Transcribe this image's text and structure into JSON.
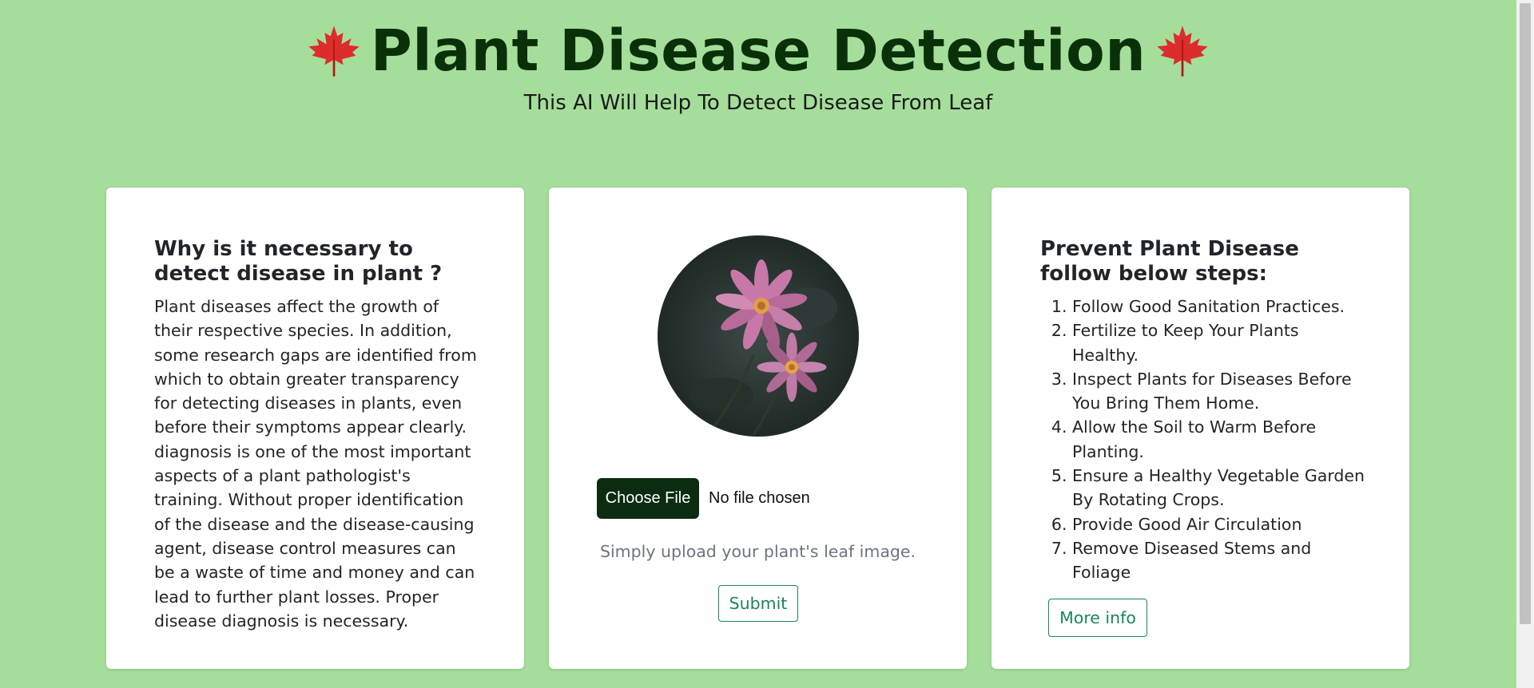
{
  "header": {
    "title": "Plant Disease Detection",
    "subtitle": "This AI Will Help To Detect Disease From Leaf",
    "icon": "maple-leaf-icon"
  },
  "why_card": {
    "heading": "Why is it necessary to detect disease in plant ?",
    "body": "Plant diseases affect the growth of their respective species. In addition, some research gaps are identified from which to obtain greater transparency for detecting diseases in plants, even before their symptoms appear clearly. diagnosis is one of the most important aspects of a plant pathologist's training. Without proper identification of the disease and the disease-causing agent, disease control measures can be a waste of time and money and can lead to further plant losses. Proper disease diagnosis is necessary."
  },
  "upload_card": {
    "image": "pink-flower-image",
    "choose_file_label": "Choose File",
    "file_status": "No file chosen",
    "help_text": "Simply upload your plant's leaf image.",
    "submit_label": "Submit"
  },
  "prevent_card": {
    "heading": "Prevent Plant Disease follow below steps:",
    "steps": [
      "Follow Good Sanitation Practices.",
      "Fertilize to Keep Your Plants Healthy.",
      "Inspect Plants for Diseases Before You Bring Them Home.",
      "Allow the Soil to Warm Before Planting.",
      "Ensure a Healthy Vegetable Garden By Rotating Crops.",
      "Provide Good Air Circulation",
      "Remove Diseased Stems and Foliage"
    ],
    "more_info_label": "More info"
  },
  "colors": {
    "background": "#a5de9b",
    "title": "#0a3009",
    "accent": "#198754",
    "file_button": "#0b2c10"
  }
}
